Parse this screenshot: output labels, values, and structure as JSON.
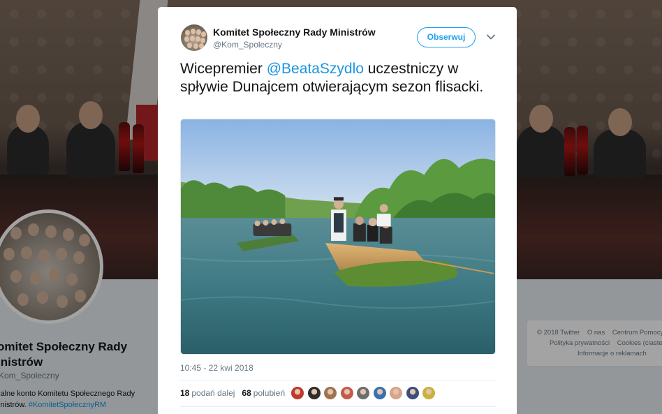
{
  "background": {
    "profile": {
      "name": "Komitet Społeczny Rady Ministrów",
      "name_line1": "omitet Społeczny Rady",
      "name_line2": "inistrów",
      "handle": "Kom_Spoleczny",
      "bio_line1": "jalne konto Komitetu Społecznego Rady",
      "bio_line2_prefix": "inistrów. ",
      "bio_hashtag": "#KomitetSpołecznyRM"
    },
    "footer": {
      "row1": [
        "© 2018 Twitter",
        "O nas",
        "Centrum Pomocy"
      ],
      "row2": [
        "Polityka prywatności",
        "Cookies (ciastec"
      ],
      "row3": [
        "Informacje o reklamach"
      ]
    }
  },
  "tweet": {
    "author_name": "Komitet Społeczny Rady Ministrów",
    "author_handle": "@Kom_Spoleczny",
    "follow_label": "Obserwuj",
    "text_before": "Wicepremier ",
    "mention": "@BeataSzydlo",
    "text_after": " uczestniczy w spływie Dunajcem otwierającym sezon flisacki.",
    "timestamp": "10:45 - 22 kwi 2018",
    "retweets_count": "18",
    "retweets_label": "podań dalej",
    "likes_count": "68",
    "likes_label": "polubień",
    "liker_colors": [
      "#c0392b",
      "#2c2c2c",
      "#a0724f",
      "#c45a4a",
      "#6d6d6d",
      "#3b6fb0",
      "#d8a48a",
      "#3a4f7a",
      "#c9b23b"
    ]
  },
  "icons": {
    "caret": "chevron-down-icon"
  }
}
